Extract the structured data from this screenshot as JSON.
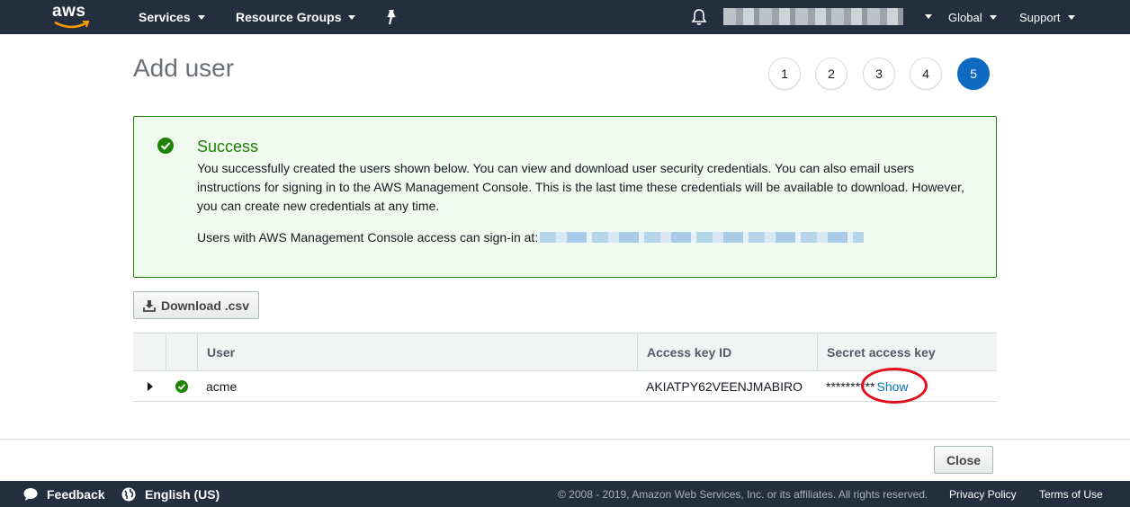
{
  "topnav": {
    "logo_text": "aws",
    "services_label": "Services",
    "resource_groups_label": "Resource Groups",
    "region_label": "Global",
    "support_label": "Support"
  },
  "header": {
    "title": "Add user",
    "steps": [
      "1",
      "2",
      "3",
      "4",
      "5"
    ],
    "active_step": "5"
  },
  "success": {
    "title": "Success",
    "message": "You successfully created the users shown below. You can view and download user security credentials. You can also email users instructions for signing in to the AWS Management Console. This is the last time these credentials will be available to download. However, you can create new credentials at any time.",
    "signin_label": "Users with AWS Management Console access can sign-in at:"
  },
  "download_button_label": "Download .csv",
  "table": {
    "headers": [
      "User",
      "Access key ID",
      "Secret access key"
    ],
    "rows": [
      {
        "user": "acme",
        "access_key_id": "AKIATPY62VEENJMABIRO",
        "secret_masked": "**********",
        "show_label": "Show"
      }
    ]
  },
  "close_button_label": "Close",
  "footer": {
    "feedback_label": "Feedback",
    "language_label": "English (US)",
    "copyright": "© 2008 - 2019, Amazon Web Services, Inc. or its affiliates. All rights reserved.",
    "privacy_label": "Privacy Policy",
    "terms_label": "Terms of Use"
  },
  "colors": {
    "nav_bg": "#232f3e",
    "success_green": "#1d8102",
    "active_step_blue": "#0e6ac0",
    "link_blue": "#0073bb",
    "highlight_red": "#e0101a"
  },
  "icons": [
    "bell-icon",
    "pin-icon",
    "check-circle-icon",
    "download-icon",
    "expand-icon",
    "speech-bubble-icon",
    "globe-icon"
  ]
}
